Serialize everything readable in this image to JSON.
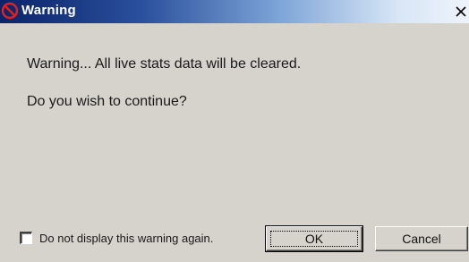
{
  "window": {
    "title": "Warning",
    "title_icon": "no-entry-icon",
    "close_glyph": "X"
  },
  "body": {
    "message": "Warning... All live stats data will be cleared.",
    "question": "Do you wish to continue?"
  },
  "options": {
    "dont_show_label": "Do not display this warning again.",
    "dont_show_checked": false
  },
  "buttons": {
    "ok_label": "OK",
    "cancel_label": "Cancel"
  },
  "colors": {
    "titlebar_start": "#0a246a",
    "titlebar_end": "#eef3fa",
    "dialog_bg": "#d6d3cc",
    "icon_red": "#d01818"
  }
}
